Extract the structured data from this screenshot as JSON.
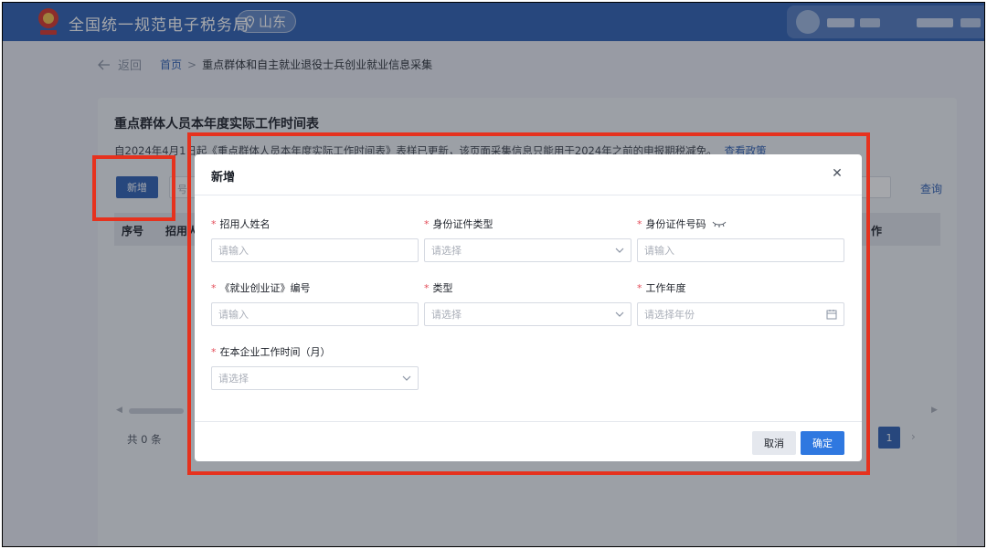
{
  "header": {
    "site_title": "全国统一规范电子税务局",
    "region": "山东"
  },
  "breadcrumb": {
    "back": "返回",
    "home": "首页",
    "separator": ">",
    "current": "重点群体和自主就业退役士兵创业就业信息采集"
  },
  "page": {
    "title": "重点群体人员本年度实际工作时间表",
    "notice": "自2024年4月1日起《重点群体人员本年度实际工作时间表》表样已更新，该页面采集信息只能用于2024年之前的申报期税减免。",
    "policy_link": "查看政策",
    "add_button": "新增",
    "search_placeholder": "号",
    "query_button": "查询",
    "columns": [
      "序号",
      "招用人",
      "作"
    ],
    "total": "共 0 条",
    "current_page": "1"
  },
  "modal": {
    "title": "新增",
    "fields": [
      {
        "label": "招用人姓名",
        "placeholder": "请输入",
        "type": "input"
      },
      {
        "label": "身份证件类型",
        "placeholder": "请选择",
        "type": "select"
      },
      {
        "label": "身份证件号码",
        "placeholder": "请输入",
        "type": "input"
      },
      {
        "label": "《就业创业证》编号",
        "placeholder": "请输入",
        "type": "input"
      },
      {
        "label": "类型",
        "placeholder": "请选择",
        "type": "select"
      },
      {
        "label": "工作年度",
        "placeholder": "请选择年份",
        "type": "date"
      },
      {
        "label": "在本企业工作时间（月）",
        "placeholder": "请选择",
        "type": "select"
      }
    ],
    "required_mark": "*",
    "cancel": "取消",
    "confirm": "确定"
  },
  "colors": {
    "brand_blue": "#2d5fb3",
    "confirm_blue": "#2f78e0",
    "highlight_red": "#e6321e",
    "required_red": "#e34d59"
  }
}
